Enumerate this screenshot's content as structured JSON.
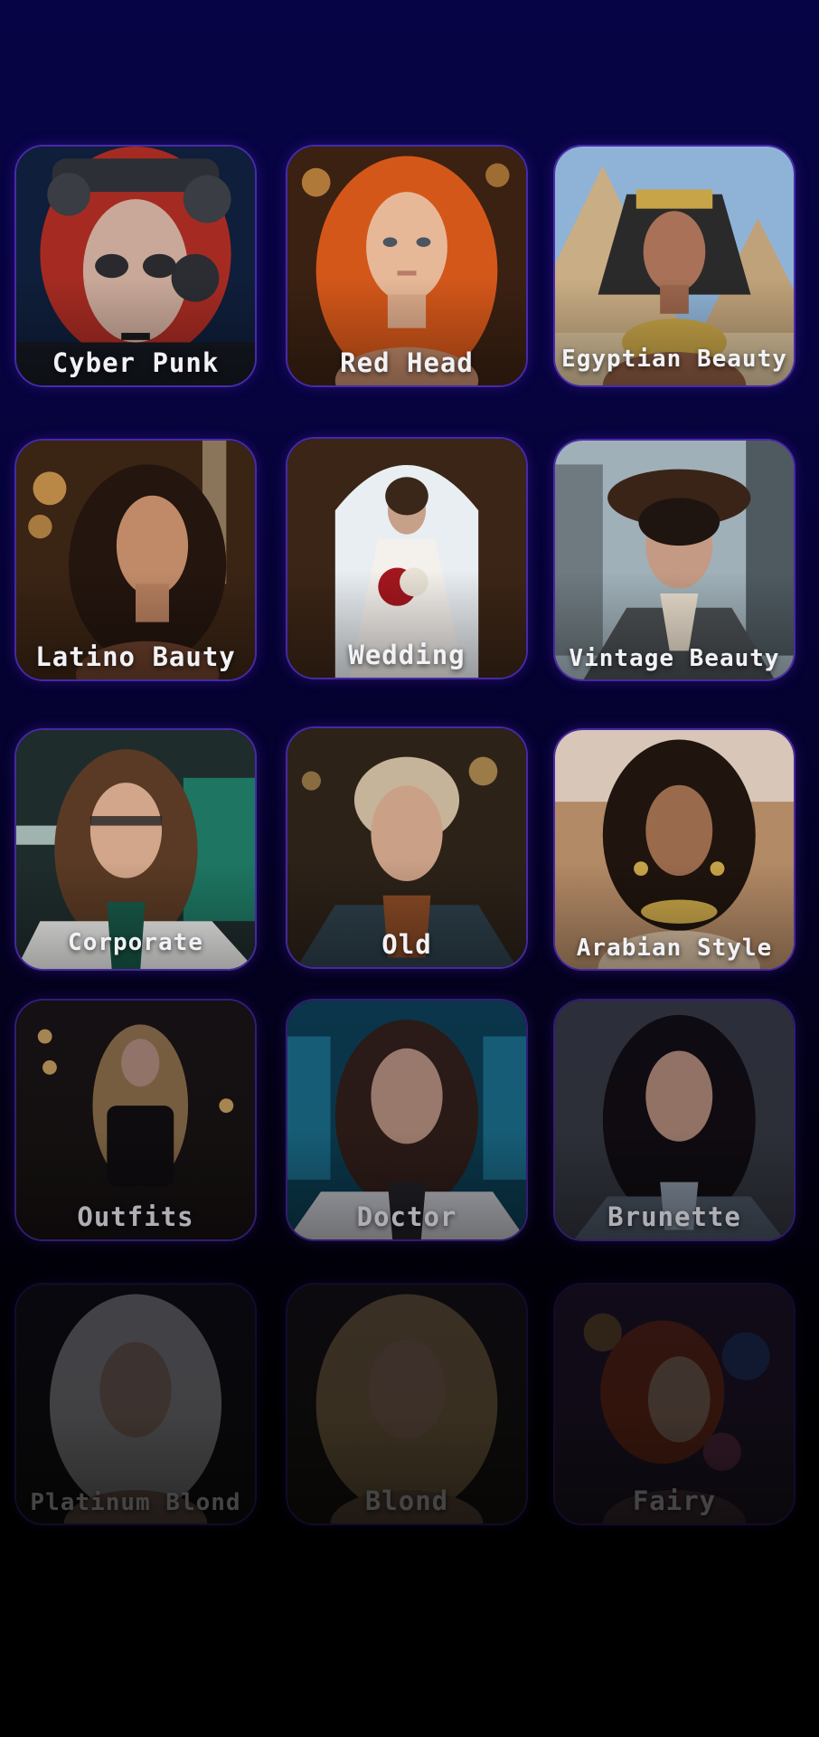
{
  "styles": [
    {
      "label": "Cyber Punk",
      "icon": "cyberpunk-portrait"
    },
    {
      "label": "Red Head",
      "icon": "redhead-portrait"
    },
    {
      "label": "Egyptian Beauty",
      "icon": "egyptian-portrait"
    },
    {
      "label": "Latino Bauty",
      "icon": "latino-portrait"
    },
    {
      "label": "Wedding",
      "icon": "wedding-portrait"
    },
    {
      "label": "Vintage Beauty",
      "icon": "vintage-portrait"
    },
    {
      "label": "Corporate",
      "icon": "corporate-portrait"
    },
    {
      "label": "Old",
      "icon": "old-portrait"
    },
    {
      "label": "Arabian Style",
      "icon": "arabian-portrait"
    },
    {
      "label": "Outfits",
      "icon": "outfits-portrait"
    },
    {
      "label": "Doctor",
      "icon": "doctor-portrait"
    },
    {
      "label": "Brunette",
      "icon": "brunette-portrait"
    },
    {
      "label": "Platinum Blond",
      "icon": "platinum-portrait"
    },
    {
      "label": "Blond",
      "icon": "blond-portrait"
    },
    {
      "label": "Fairy",
      "icon": "fairy-portrait"
    }
  ],
  "colors": {
    "background_top": "#070445",
    "background_bottom": "#000000",
    "card_border": "#7c4dff",
    "label_text": "#f2f2f6"
  }
}
